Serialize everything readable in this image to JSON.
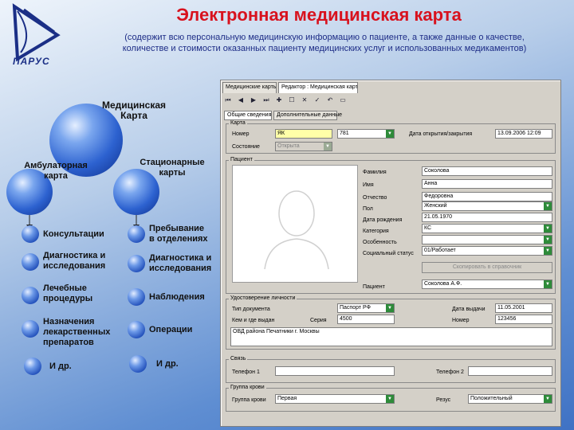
{
  "header": {
    "logo_text": "ПАРУС",
    "title": "Электронная медицинская карта",
    "subtitle_line1": "(содержит всю персональную медицинскую информацию о пациенте, а также данные о качестве,",
    "subtitle_line2": "количестве и стоимости оказанных пациенту медицинских услуг и использованных медикаментов)"
  },
  "diagram": {
    "root": {
      "line1": "Медицинская",
      "line2": "Карта"
    },
    "left": {
      "line1": "Амбулаторная",
      "line2": "карта",
      "items": [
        [
          "Консультации"
        ],
        [
          "Диагностика и",
          "исследования"
        ],
        [
          "Лечебные",
          "процедуры"
        ],
        [
          "Назначения",
          "лекарственных",
          "препаратов"
        ],
        [
          "И др."
        ]
      ]
    },
    "right": {
      "line1": "Стационарные",
      "line2": "карты",
      "items": [
        [
          "Пребывание",
          "в отделениях"
        ],
        [
          "Диагностика и",
          "исследования"
        ],
        [
          "Наблюдения"
        ],
        [
          "Операции"
        ],
        [
          "И др."
        ]
      ]
    }
  },
  "window": {
    "tabs": [
      "Медицинские карты",
      "Редактор : Медицинская карта"
    ],
    "toolbar_icons": [
      "⏮",
      "◀",
      "▶",
      "⏭",
      "✚",
      "☐",
      "✕",
      "✓",
      "↶",
      "▭"
    ],
    "subtabs": [
      "Общие сведения",
      "Дополнительные данные"
    ],
    "card": {
      "label": "Карта",
      "number_label": "Номер",
      "number_prefix": "ЯК",
      "number_value": "781",
      "state_label": "Состояние",
      "state_value": "Открыта",
      "open_date_label": "Дата открытия/закрытия",
      "open_date_value": "13.09.2006 12:09"
    },
    "patient": {
      "label": "Пациент",
      "fields": [
        {
          "label": "Фамилия",
          "value": "Соколова"
        },
        {
          "label": "Имя",
          "value": "Анна"
        },
        {
          "label": "Отчество",
          "value": "Федоровна"
        },
        {
          "label": "Пол",
          "value": "Женский"
        },
        {
          "label": "Дата рождения",
          "value": "21.05.1970"
        },
        {
          "label": "Категория",
          "value": "КС"
        },
        {
          "label": "Особенность",
          "value": ""
        },
        {
          "label": "Социальный статус",
          "value": "01/Работает"
        },
        {
          "label": "",
          "value": ""
        },
        {
          "label": "Пациент",
          "value": "Соколова А.Ф."
        }
      ],
      "copy_button": "Скопировать в справочник"
    },
    "identity": {
      "label": "Удостоверение личности",
      "doc_type_label": "Тип документа",
      "doc_type_value": "Паспорт РФ",
      "issue_date_label": "Дата выдачи",
      "issue_date_value": "11.05.2001",
      "issued_by_label": "Кем и где выдан",
      "series_label": "Серия",
      "series_value": "4500",
      "number_label": "Номер",
      "number_value": "123456",
      "issued_text": "ОВД района Печатники г. Москвы"
    },
    "phones": {
      "label": "Связь",
      "phone1_label": "Телефон 1",
      "phone1_value": "",
      "phone2_label": "Телефон 2",
      "phone2_value": ""
    },
    "blood": {
      "label": "Группа крови",
      "group_label": "Группа крови",
      "group_value": "Первая",
      "rh_label": "Резус",
      "rh_value": "Положительный"
    }
  }
}
